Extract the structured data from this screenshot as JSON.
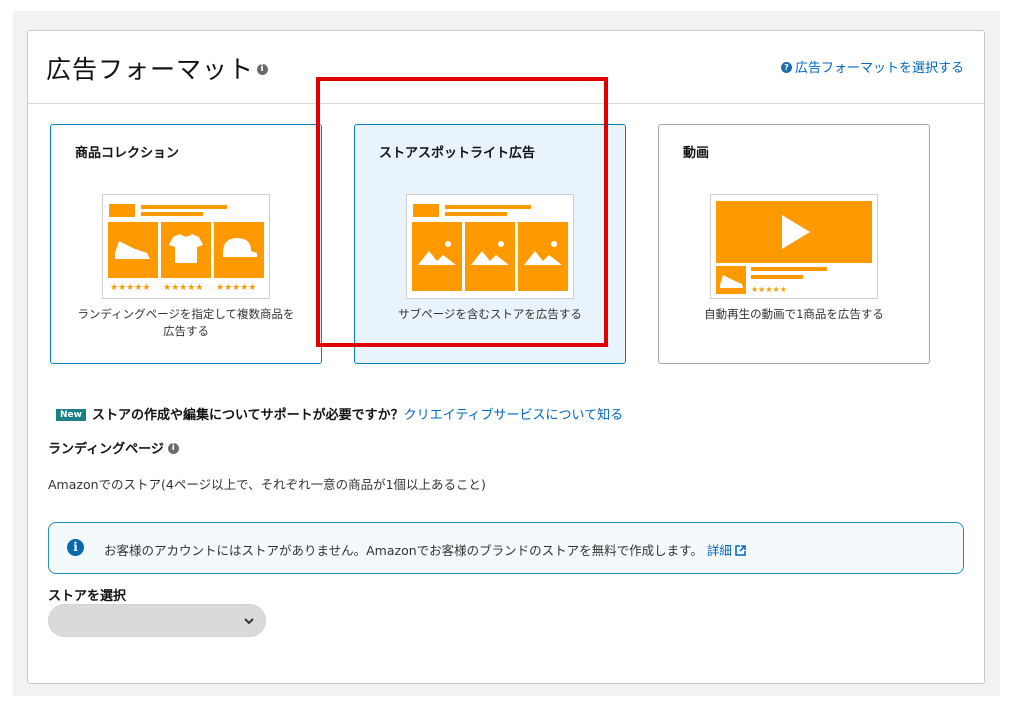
{
  "header": {
    "title": "広告フォーマット",
    "help_link": "広告フォーマットを選択する"
  },
  "formats": [
    {
      "title": "商品コレクション",
      "desc_line1": "ランディングページを指定して複数商品を",
      "desc_line2": "広告する"
    },
    {
      "title": "ストアスポットライト広告",
      "desc_line1": "サブページを含むストアを広告する",
      "desc_line2": ""
    },
    {
      "title": "動画",
      "desc_line1": "自動再生の動画で1商品を広告する",
      "desc_line2": ""
    }
  ],
  "promo": {
    "badge": "New",
    "text": "ストアの作成や編集についてサポートが必要ですか？",
    "link": "クリエイティブサービスについて知る"
  },
  "landing_page": {
    "label": "ランディングページ",
    "description": "Amazonでのストア(4ページ以上で、それぞれ一意の商品が1個以上あること)"
  },
  "alert": {
    "text": "お客様のアカウントにはストアがありません。Amazonでお客様のブランドのストアを無料で作成します。",
    "link": "詳細"
  },
  "store_select": {
    "label": "ストアを選択",
    "value": ""
  },
  "colors": {
    "accent_orange": "#ff9900",
    "link_blue": "#0066c0",
    "selected_border": "#007fc7",
    "highlight_red": "#e00000"
  }
}
